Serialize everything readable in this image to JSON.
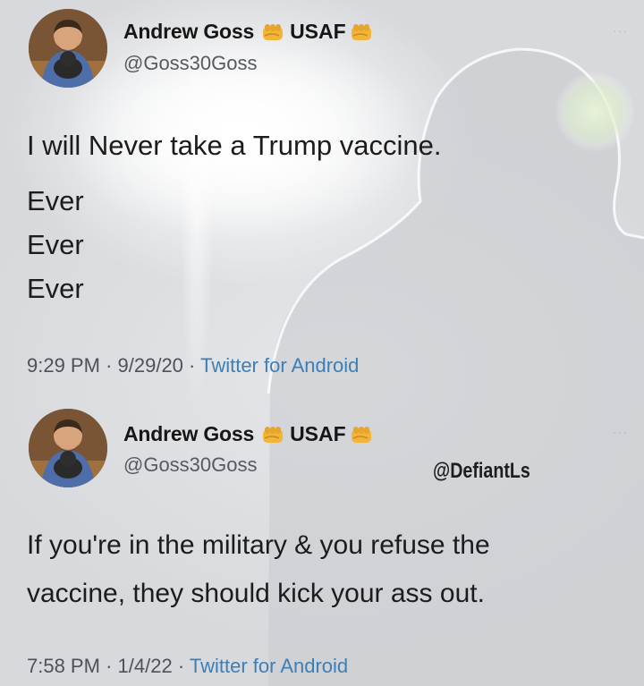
{
  "tweets": [
    {
      "name": "Andrew Goss",
      "badge": "USAF",
      "handle": "@Goss30Goss",
      "more": "···",
      "text_lines": [
        "I will Never take a Trump vaccine.",
        "Ever",
        "Ever",
        "Ever"
      ],
      "time": "9:29 PM",
      "date": "9/29/20",
      "source": "Twitter for Android"
    },
    {
      "name": "Andrew Goss",
      "badge": "USAF",
      "handle": "@Goss30Goss",
      "more": "···",
      "text_lines": [
        "If you're in the military & you refuse the",
        "vaccine, they should kick your ass out."
      ],
      "time": "7:58 PM",
      "date": "1/4/22",
      "source": "Twitter for Android"
    }
  ],
  "watermark": "@DefiantLs",
  "colors": {
    "source_link": "#3d7fb5",
    "handle": "#555a60",
    "text": "#1c1c1c"
  },
  "icons": [
    "avatar-photo",
    "oncoming-fist-emoji",
    "more-dots-icon"
  ]
}
